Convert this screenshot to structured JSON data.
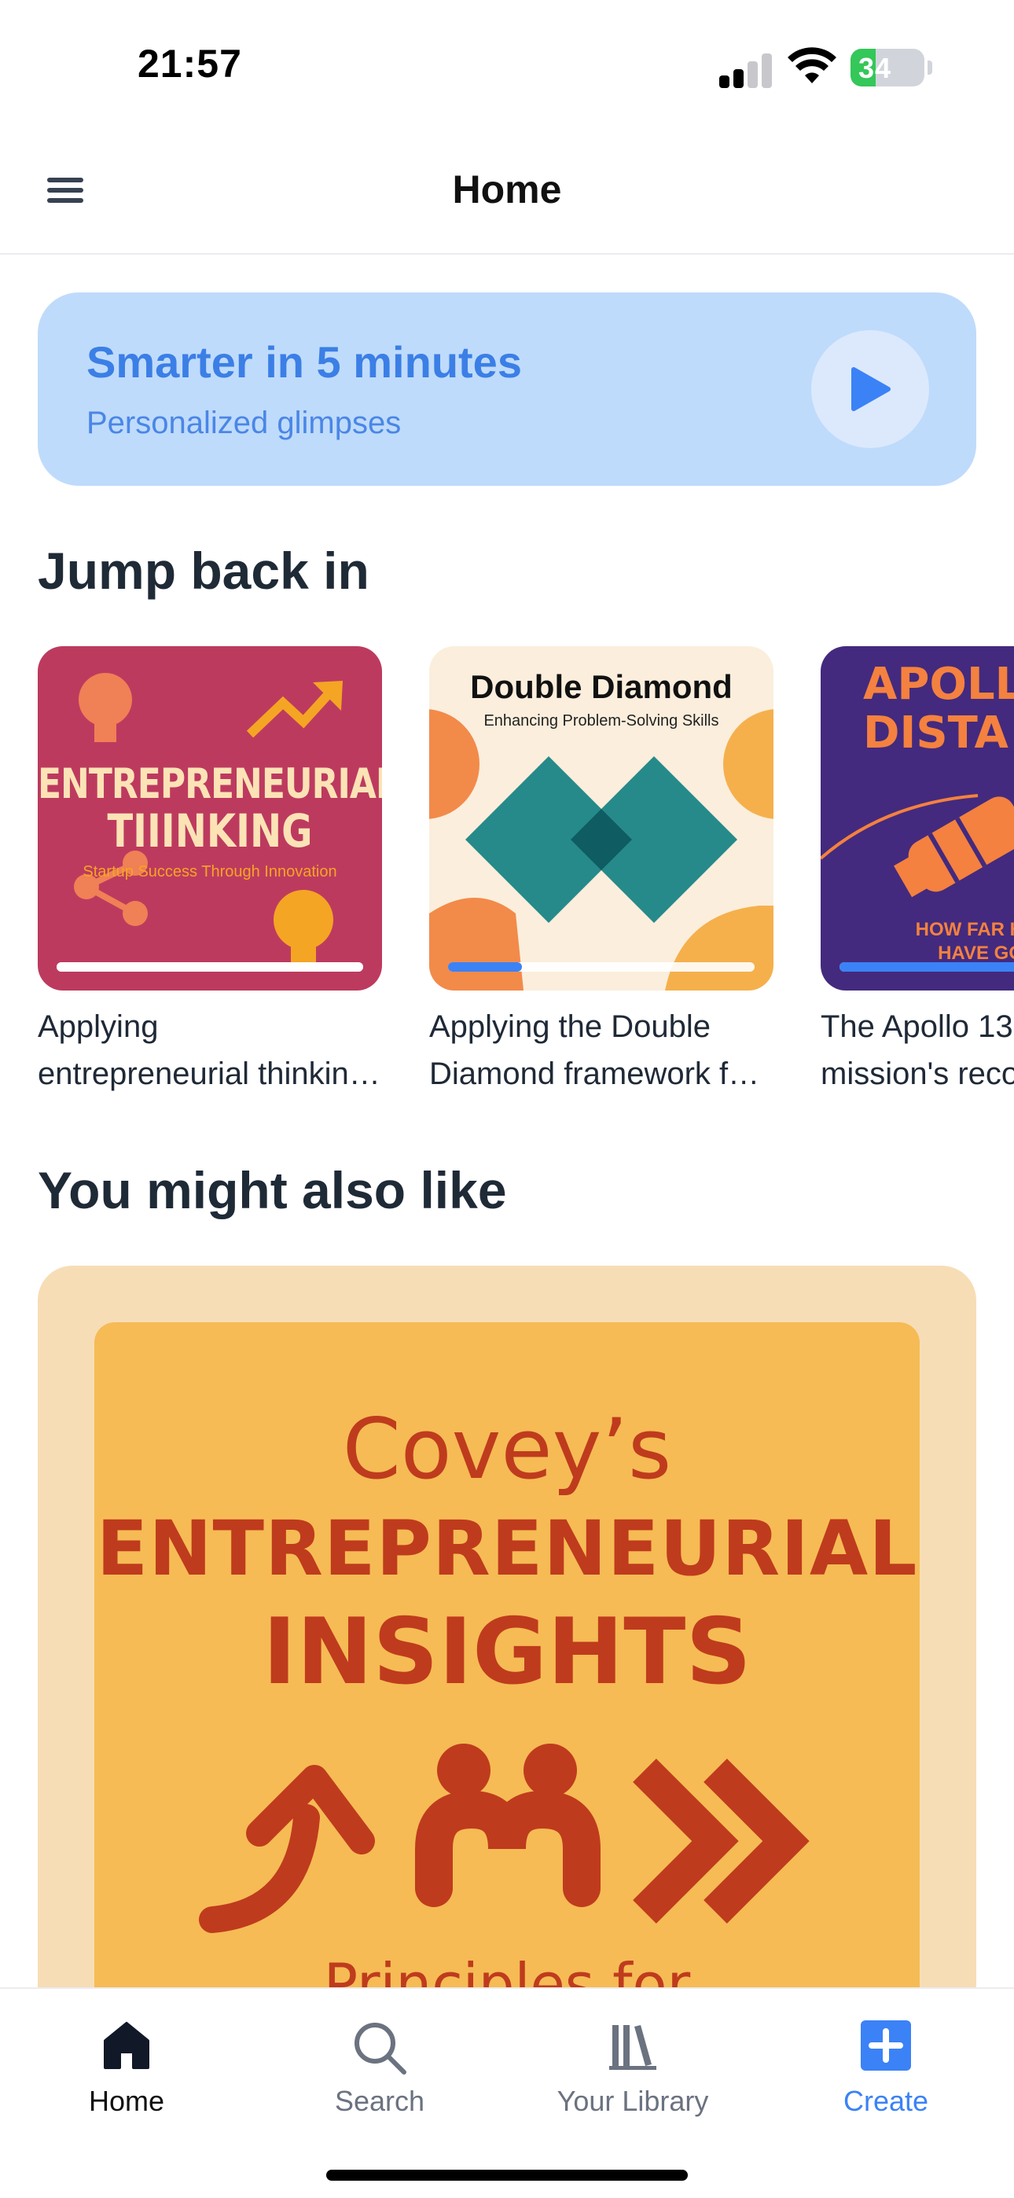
{
  "status_bar": {
    "time": "21:57",
    "battery": "34",
    "battery_level": 0.34
  },
  "header": {
    "title": "Home"
  },
  "promo": {
    "title": "Smarter in 5 minutes",
    "subtitle": "Personalized glimpses"
  },
  "jump_back": {
    "title": "Jump back in",
    "items": [
      {
        "title_line1": "Applying",
        "title_line2": "entrepreneurial thinking for startup success",
        "cover_title_line1": "ENTREPRENEURIAL",
        "cover_title_line2": "TIIINKING",
        "cover_subtitle": "Startup Success Through Innovation",
        "progress": 1.0
      },
      {
        "title_line1": "Applying the Double",
        "title_line2": "Diamond framework for problem solving",
        "cover_title": "Double Diamond",
        "cover_subtitle": "Enhancing Problem-Solving Skills",
        "progress": 0.24
      },
      {
        "title_line1": "The Apollo 13",
        "title_line2": "mission's record distance",
        "cover_title_line1": "APOLLO",
        "cover_title_line2": "DISTA",
        "cover_subtitle_line1": "HOW FAR H",
        "cover_subtitle_line2": "HAVE GO",
        "progress": 1.0
      }
    ]
  },
  "recommend": {
    "title": "You might also like",
    "cover_line1": "Covey’s",
    "cover_line2": "ENTREPRENEURIAL",
    "cover_line3": "INSIGHTS",
    "cover_line4": "Principles for"
  },
  "tabs": [
    {
      "label": "Home",
      "icon": "home-icon"
    },
    {
      "label": "Search",
      "icon": "search-icon"
    },
    {
      "label": "Your Library",
      "icon": "library-icon"
    },
    {
      "label": "Create",
      "icon": "plus-square-icon"
    }
  ],
  "colors": {
    "accent": "#3b82f6",
    "promo_bg": "#bfdbfb",
    "card1_bg": "#bd3a5f",
    "card2_bg": "#fbeedc",
    "card3_bg": "#432a7e",
    "rec_bg": "#f7ddb6",
    "rec_cover": "#f6bb55"
  }
}
